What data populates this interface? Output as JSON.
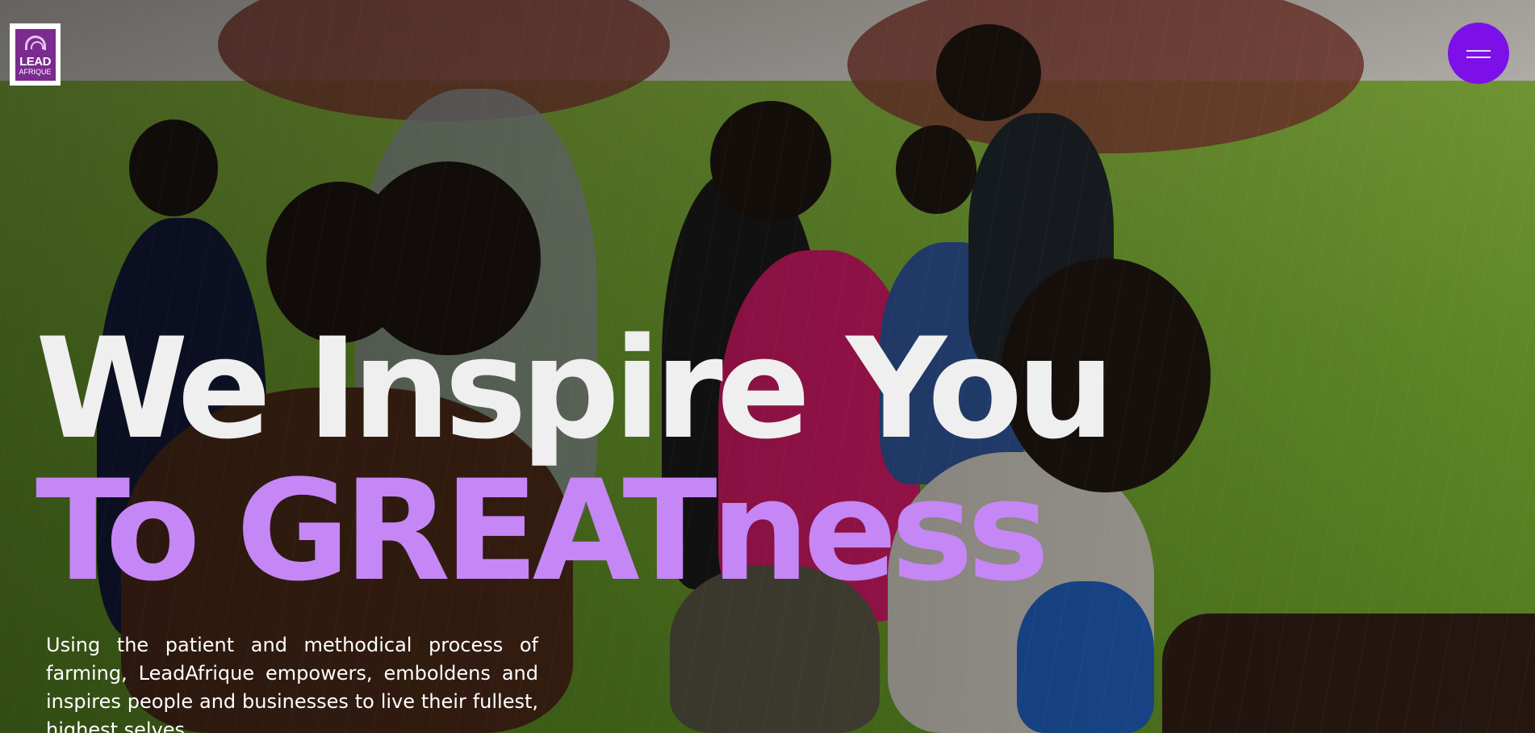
{
  "logo": {
    "line1": "LEAD",
    "line2": "AFRIQUE",
    "icon": "leadafrique-logo-icon"
  },
  "menu": {
    "icon": "hamburger-menu-icon",
    "color": "#7d10e8"
  },
  "hero": {
    "headline_line1": "We Inspire You",
    "headline_line2": "To GREATness",
    "headline_line1_color": "#efefef",
    "headline_line2_color": "#c587f5",
    "tagline": "Using the patient and methodical process of farming, LeadAfrique empowers, emboldens and inspires people and businesses to live their fullest, highest selves."
  }
}
